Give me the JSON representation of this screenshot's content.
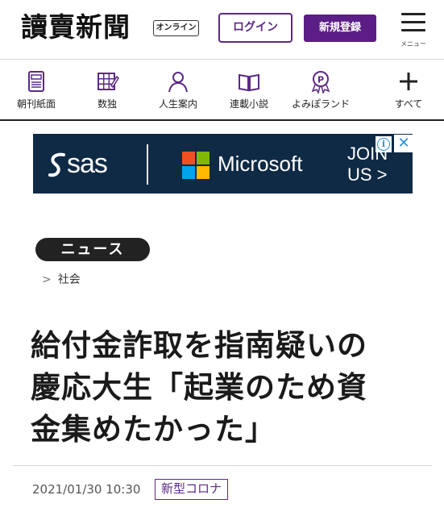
{
  "header": {
    "logo_text": "讀賣新聞",
    "online_badge": "オンライン",
    "login_label": "ログイン",
    "register_label": "新規登録",
    "menu_label": "メニュー",
    "brand_color": "#5b2a86"
  },
  "nav": {
    "items": [
      {
        "label": "朝刊紙面",
        "icon": "newspaper-icon"
      },
      {
        "label": "数独",
        "icon": "sudoku-grid-icon"
      },
      {
        "label": "人生案内",
        "icon": "person-icon"
      },
      {
        "label": "連載小説",
        "icon": "book-icon"
      },
      {
        "label": "よみぽランド",
        "icon": "points-badge-icon"
      },
      {
        "label": "すべて",
        "icon": "plus-icon"
      }
    ]
  },
  "ad": {
    "brand1": "sas",
    "brand2": "Microsoft",
    "cta_line1": "JOIN",
    "cta_line2": "US >",
    "info_glyph": "i",
    "close_glyph": "✕",
    "background": "#0f2a45"
  },
  "article": {
    "category": "ニュース",
    "breadcrumb_sep": ">",
    "breadcrumb_item": "社会",
    "headline_lines": [
      "給付金詐取を指南疑いの",
      "慶応大生「起業のため資",
      "金集めたかった」"
    ],
    "datetime": "2021/01/30 10:30",
    "tag": "新型コロナ"
  }
}
